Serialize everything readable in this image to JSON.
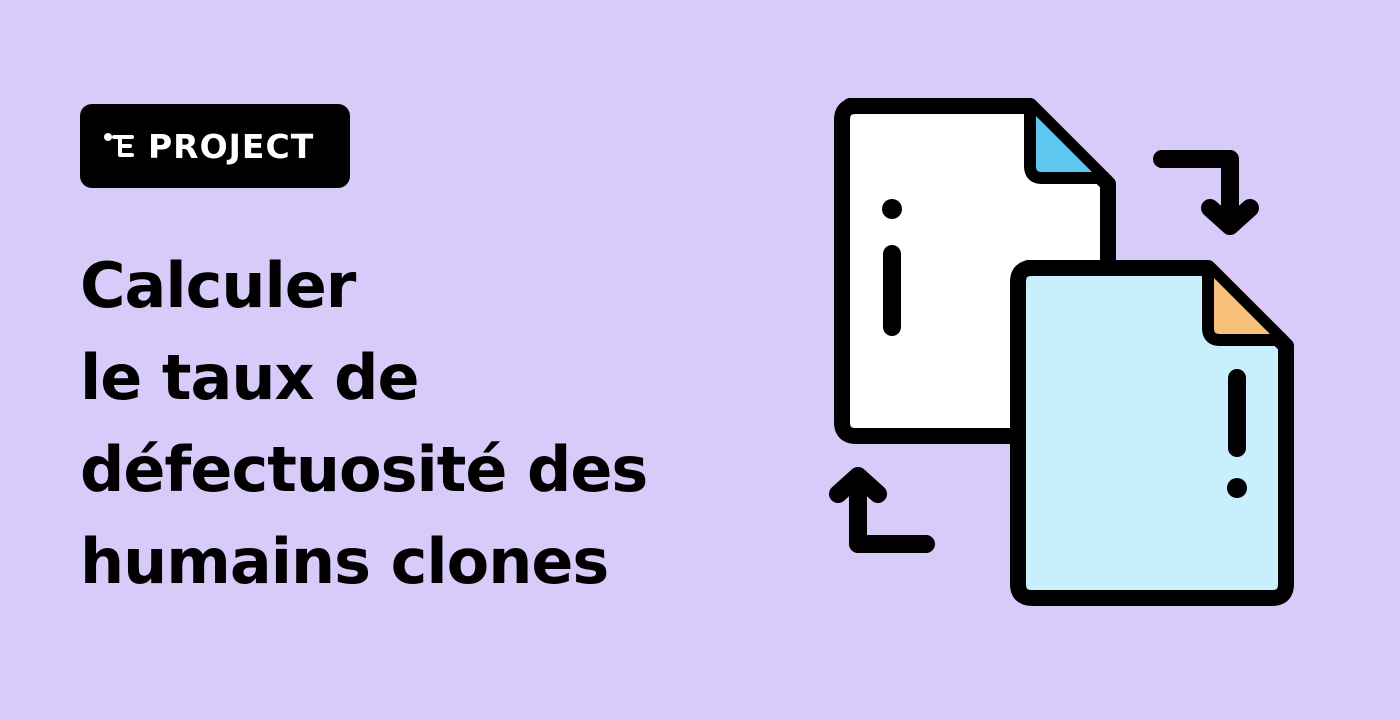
{
  "badge": {
    "icon": "project-tree-icon",
    "label": "PROJECT"
  },
  "title": {
    "lines": [
      "Calculer",
      "le taux de",
      "défectuosité des",
      "humains clones"
    ]
  },
  "illustration": {
    "icon": "file-swap-icon",
    "colors": {
      "background": "#d8cbfa",
      "back_document": "#ffffff",
      "back_corner": "#5fc8f0",
      "front_document": "#c8f0fc",
      "front_corner": "#f6c07a",
      "outline": "#000000"
    }
  }
}
